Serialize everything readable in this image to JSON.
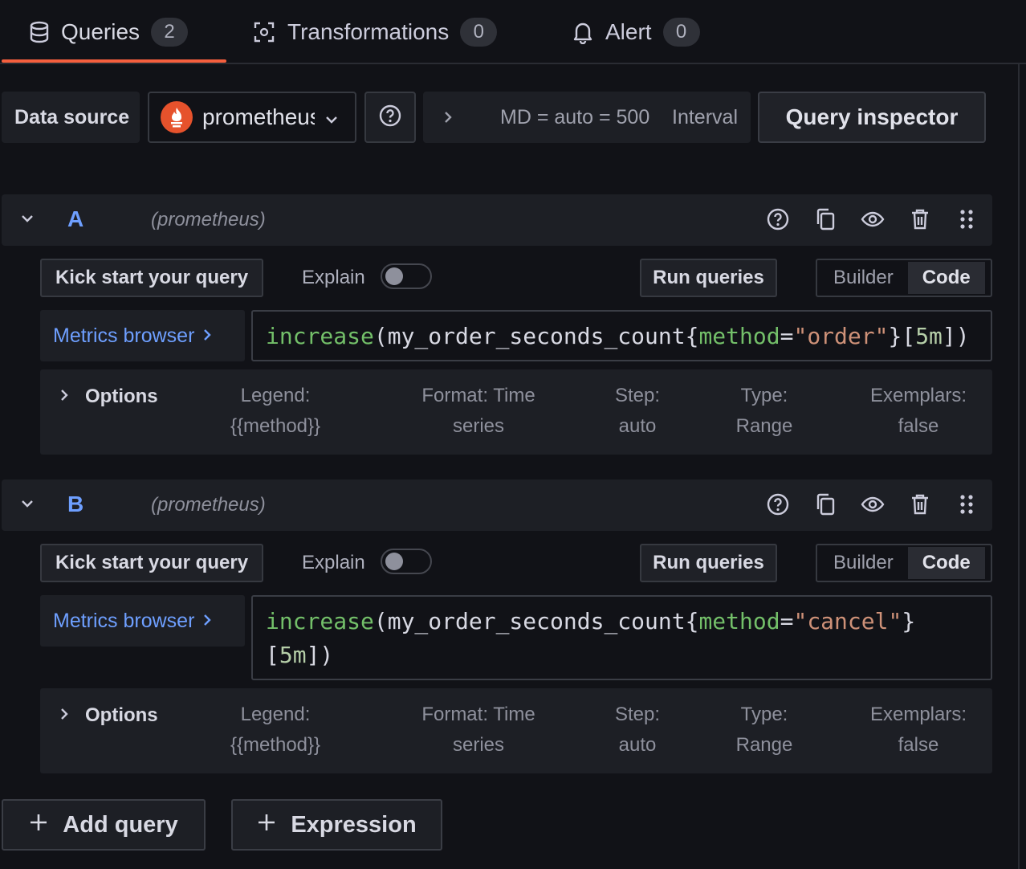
{
  "tabs": [
    {
      "label": "Queries",
      "count": "2",
      "icon": "database-icon"
    },
    {
      "label": "Transformations",
      "count": "0",
      "icon": "transform-icon"
    },
    {
      "label": "Alert",
      "count": "0",
      "icon": "bell-icon"
    }
  ],
  "toolbar": {
    "data_source_label": "Data source",
    "data_source_value": "prometheus",
    "query_options": "MD = auto = 500    Interval",
    "query_inspector": "Query inspector"
  },
  "queries": [
    {
      "letter": "A",
      "datasource": "(prometheus)",
      "kick_start": "Kick start your query",
      "explain": "Explain",
      "run": "Run queries",
      "mode_builder": "Builder",
      "mode_code": "Code",
      "metrics_browser": "Metrics browser",
      "expr": {
        "fn": "increase",
        "metric": "my_order_seconds_count",
        "label": "method",
        "value": "\"order\"",
        "range": "5m"
      },
      "options": {
        "title": "Options",
        "legend_k": "Legend:",
        "legend_v": "{{method}}",
        "format_k": "Format: Time",
        "format_v": "series",
        "step_k": "Step:",
        "step_v": "auto",
        "type_k": "Type:",
        "type_v": "Range",
        "exemplars_k": "Exemplars:",
        "exemplars_v": "false"
      }
    },
    {
      "letter": "B",
      "datasource": "(prometheus)",
      "kick_start": "Kick start your query",
      "explain": "Explain",
      "run": "Run queries",
      "mode_builder": "Builder",
      "mode_code": "Code",
      "metrics_browser": "Metrics browser",
      "expr": {
        "fn": "increase",
        "metric": "my_order_seconds_count",
        "label": "method",
        "value": "\"cancel\"",
        "range": "5m"
      },
      "options": {
        "title": "Options",
        "legend_k": "Legend:",
        "legend_v": "{{method}}",
        "format_k": "Format: Time",
        "format_v": "series",
        "step_k": "Step:",
        "step_v": "auto",
        "type_k": "Type:",
        "type_v": "Range",
        "exemplars_k": "Exemplars:",
        "exemplars_v": "false"
      }
    }
  ],
  "footer": {
    "add_query": "Add query",
    "expression": "Expression"
  },
  "colors": {
    "accent": "#f55f3e",
    "link": "#6e9fff",
    "bg": "#111217",
    "panel": "#1d1f25"
  }
}
